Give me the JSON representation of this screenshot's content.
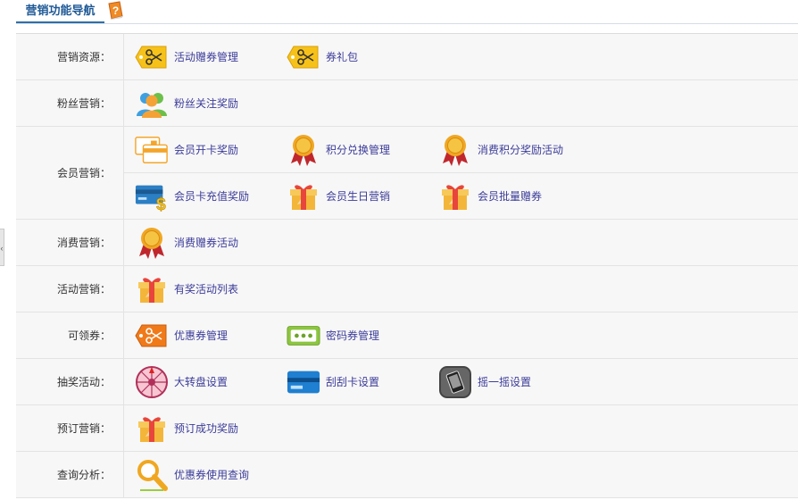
{
  "header": {
    "title": "营销功能导航",
    "help_icon": "help-book-icon"
  },
  "rows": [
    {
      "label": "营销资源：",
      "lines": [
        [
          {
            "text": "活动赠券管理",
            "icon": "coupon-scissors-icon"
          },
          {
            "text": "券礼包",
            "icon": "coupon-scissors-icon"
          }
        ]
      ]
    },
    {
      "label": "粉丝营销：",
      "lines": [
        [
          {
            "text": "粉丝关注奖励",
            "icon": "fans-people-icon"
          }
        ]
      ]
    },
    {
      "label": "会员营销：",
      "lines": [
        [
          {
            "text": "会员开卡奖励",
            "icon": "member-card-icon"
          },
          {
            "text": "积分兑换管理",
            "icon": "medal-icon"
          },
          {
            "text": "消费积分奖励活动",
            "icon": "medal-icon"
          }
        ],
        [
          {
            "text": "会员卡充值奖励",
            "icon": "card-dollar-icon"
          },
          {
            "text": "会员生日营销",
            "icon": "gift-icon"
          },
          {
            "text": "会员批量赠券",
            "icon": "gift-icon"
          }
        ]
      ]
    },
    {
      "label": "消费营销：",
      "lines": [
        [
          {
            "text": "消费赠券活动",
            "icon": "medal-icon"
          }
        ]
      ]
    },
    {
      "label": "活动营销：",
      "lines": [
        [
          {
            "text": "有奖活动列表",
            "icon": "gift-icon"
          }
        ]
      ]
    },
    {
      "label": "可领券：",
      "lines": [
        [
          {
            "text": "优惠券管理",
            "icon": "coupon-orange-icon"
          },
          {
            "text": "密码券管理",
            "icon": "password-coupon-icon"
          }
        ]
      ]
    },
    {
      "label": "抽奖活动：",
      "lines": [
        [
          {
            "text": "大转盘设置",
            "icon": "wheel-icon"
          },
          {
            "text": "刮刮卡设置",
            "icon": "scratch-card-icon"
          },
          {
            "text": "摇一摇设置",
            "icon": "shake-phone-icon"
          }
        ]
      ]
    },
    {
      "label": "预订营销：",
      "lines": [
        [
          {
            "text": "预订成功奖励",
            "icon": "gift-icon"
          }
        ]
      ]
    },
    {
      "label": "查询分析：",
      "lines": [
        [
          {
            "text": "优惠券使用查询",
            "icon": "magnifier-icon"
          }
        ]
      ]
    }
  ]
}
